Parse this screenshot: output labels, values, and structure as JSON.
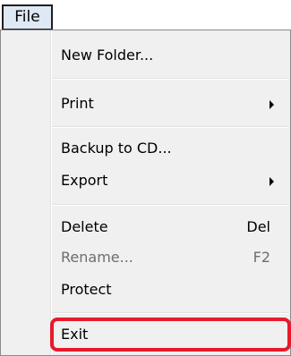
{
  "menubar": {
    "file_label": "File"
  },
  "menu": {
    "new_folder": "New Folder...",
    "print": "Print",
    "backup": "Backup to CD...",
    "export": "Export",
    "delete": "Delete",
    "delete_shortcut": "Del",
    "rename": "Rename...",
    "rename_shortcut": "F2",
    "protect": "Protect",
    "exit": "Exit"
  },
  "colors": {
    "highlight_border": "#e8192c",
    "menu_background": "#f0f0f0",
    "disabled_text": "#6d6d6d"
  }
}
